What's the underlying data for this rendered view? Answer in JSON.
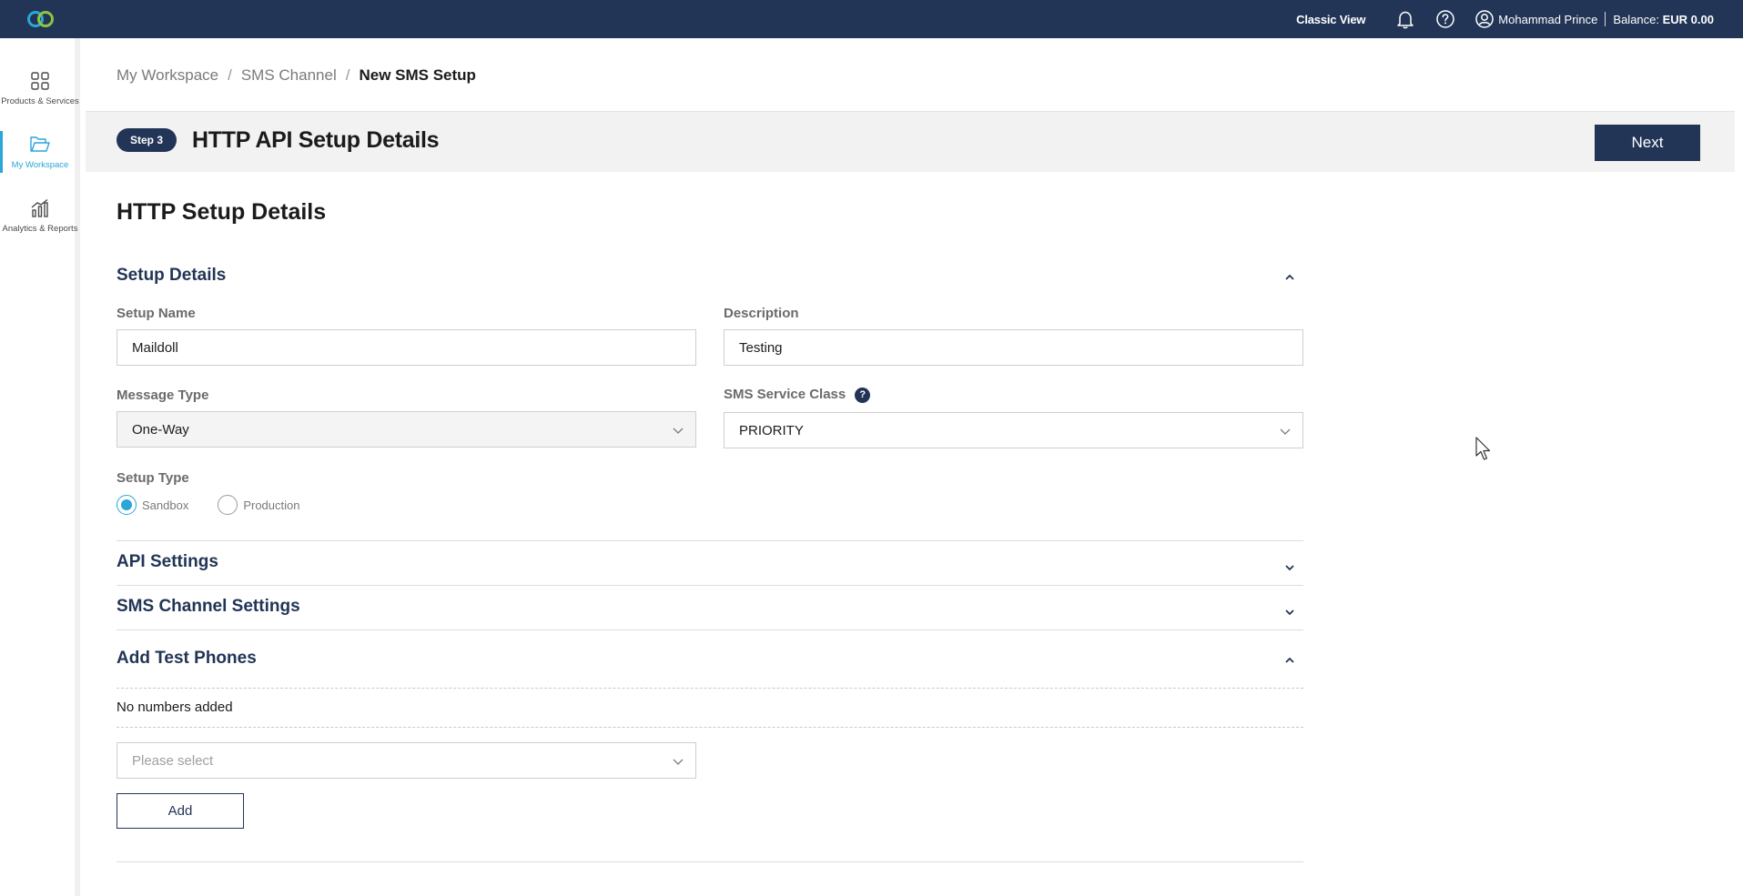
{
  "topbar": {
    "classic_view": "Classic View",
    "user_name": "Mohammad Prince",
    "balance_label": "Balance:",
    "balance_value": "EUR 0.00",
    "icons": [
      "logo-icon",
      "bell-icon",
      "help-icon",
      "user-icon"
    ]
  },
  "sidebar": {
    "items": [
      {
        "label": "Products & Services",
        "icon": "grid-icon",
        "active": false
      },
      {
        "label": "My Workspace",
        "icon": "folder-icon",
        "active": true
      },
      {
        "label": "Analytics & Reports",
        "icon": "chart-icon",
        "active": false
      }
    ]
  },
  "breadcrumb": {
    "items": [
      "My Workspace",
      "SMS Channel",
      "New SMS Setup"
    ],
    "separator": "/"
  },
  "step": {
    "badge": "Step 3",
    "title": "HTTP API Setup Details",
    "next_label": "Next"
  },
  "main": {
    "section_title": "HTTP Setup Details",
    "setup_details": {
      "title": "Setup Details",
      "setup_name_label": "Setup Name",
      "setup_name_value": "Maildoll",
      "description_label": "Description",
      "description_value": "Testing",
      "message_type_label": "Message Type",
      "message_type_value": "One-Way",
      "service_class_label": "SMS Service Class",
      "service_class_help": "?",
      "service_class_value": "PRIORITY",
      "setup_type_label": "Setup Type",
      "setup_type_options": [
        "Sandbox",
        "Production"
      ],
      "setup_type_selected": "Sandbox"
    },
    "api_settings_title": "API Settings",
    "sms_channel_settings_title": "SMS Channel Settings",
    "test_phones": {
      "title": "Add Test Phones",
      "empty_text": "No numbers added",
      "select_placeholder": "Please select",
      "add_label": "Add"
    }
  },
  "colors": {
    "navy": "#223556",
    "accent": "#2aa6d8",
    "stepbar_bg": "#f2f2f2"
  }
}
